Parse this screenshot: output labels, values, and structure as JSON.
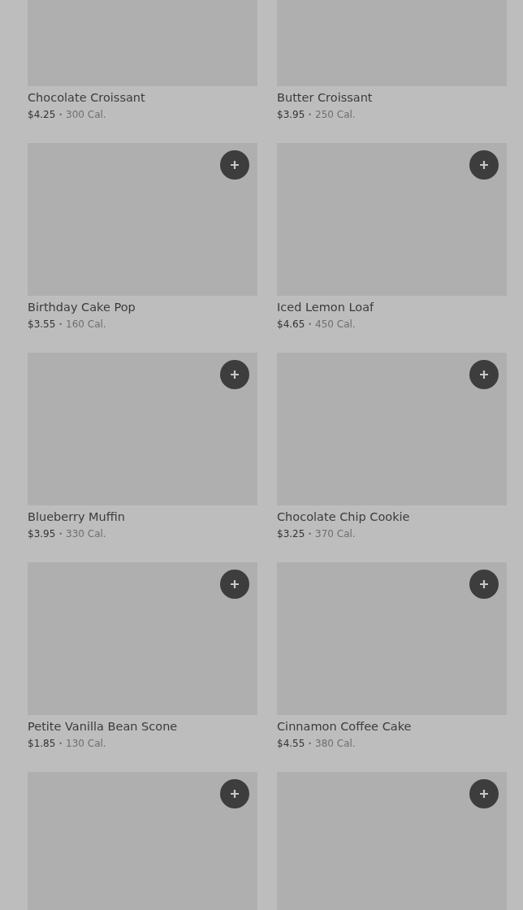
{
  "products": [
    {
      "name": "Chocolate Croissant",
      "price": "$4.25",
      "separator": "•",
      "calories": "300 Cal.",
      "add_button": false
    },
    {
      "name": "Butter Croissant",
      "price": "$3.95",
      "separator": "•",
      "calories": "250 Cal.",
      "add_button": false
    },
    {
      "name": "Birthday Cake Pop",
      "price": "$3.55",
      "separator": "•",
      "calories": "160 Cal.",
      "add_button": true
    },
    {
      "name": "Iced Lemon Loaf",
      "price": "$4.65",
      "separator": "•",
      "calories": "450 Cal.",
      "add_button": true
    },
    {
      "name": "Blueberry Muffin",
      "price": "$3.95",
      "separator": "•",
      "calories": "330 Cal.",
      "add_button": true
    },
    {
      "name": "Chocolate Chip Cookie",
      "price": "$3.25",
      "separator": "•",
      "calories": "370 Cal.",
      "add_button": true
    },
    {
      "name": "Petite Vanilla Bean Scone",
      "price": "$1.85",
      "separator": "•",
      "calories": "130 Cal.",
      "add_button": true
    },
    {
      "name": "Cinnamon Coffee Cake",
      "price": "$4.55",
      "separator": "•",
      "calories": "380 Cal.",
      "add_button": true
    },
    {
      "add_button": true
    },
    {
      "add_button": true
    }
  ]
}
